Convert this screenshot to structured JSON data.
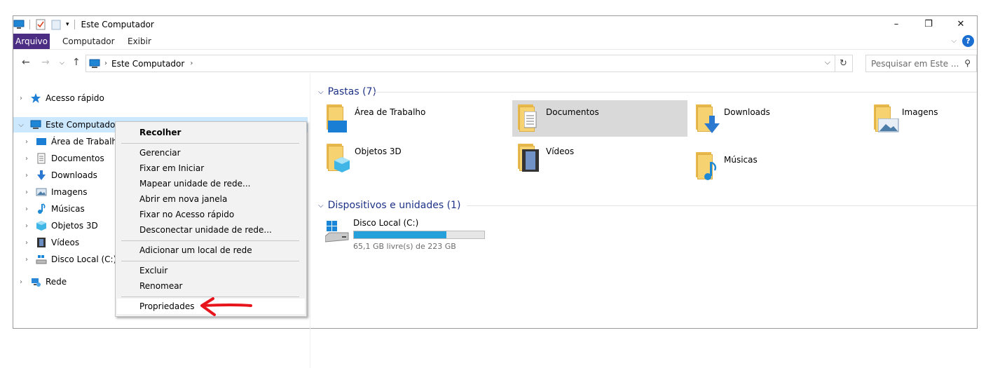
{
  "window": {
    "title": "Este Computador",
    "controls": {
      "minimize": "–",
      "maximize": "❐",
      "close": "✕"
    }
  },
  "ribbon": {
    "tabs": [
      "Arquivo",
      "Computador",
      "Exibir"
    ],
    "help_label": "?"
  },
  "address": {
    "path": "Este Computador",
    "search_placeholder": "Pesquisar em Este ..."
  },
  "nav": {
    "quick_access": "Acesso rápido",
    "this_pc": "Este Computador",
    "children": [
      "Área de Trabalho",
      "Documentos",
      "Downloads",
      "Imagens",
      "Músicas",
      "Objetos 3D",
      "Vídeos",
      "Disco Local (C:)"
    ],
    "network": "Rede"
  },
  "content": {
    "folders_header": "Pastas (7)",
    "folders": [
      "Área de Trabalho",
      "Documentos",
      "Downloads",
      "Imagens",
      "Objetos 3D",
      "Vídeos",
      "Músicas"
    ],
    "devices_header": "Dispositivos e unidades (1)",
    "drive": {
      "name": "Disco Local (C:)",
      "free_text": "65,1 GB livre(s) de 223 GB",
      "used_fraction": 0.71
    }
  },
  "context_menu": {
    "items": [
      "Recolher",
      "Gerenciar",
      "Fixar em Iniciar",
      "Mapear unidade de rede...",
      "Abrir em nova janela",
      "Fixar no Acesso rápido",
      "Desconectar unidade de rede...",
      "Adicionar um local de rede",
      "Excluir",
      "Renomear",
      "Propriedades"
    ]
  },
  "colors": {
    "file_tab": "#4b2e83",
    "accent": "#26a0da",
    "header_text": "#1e3287",
    "arrow": "#e8141c"
  }
}
